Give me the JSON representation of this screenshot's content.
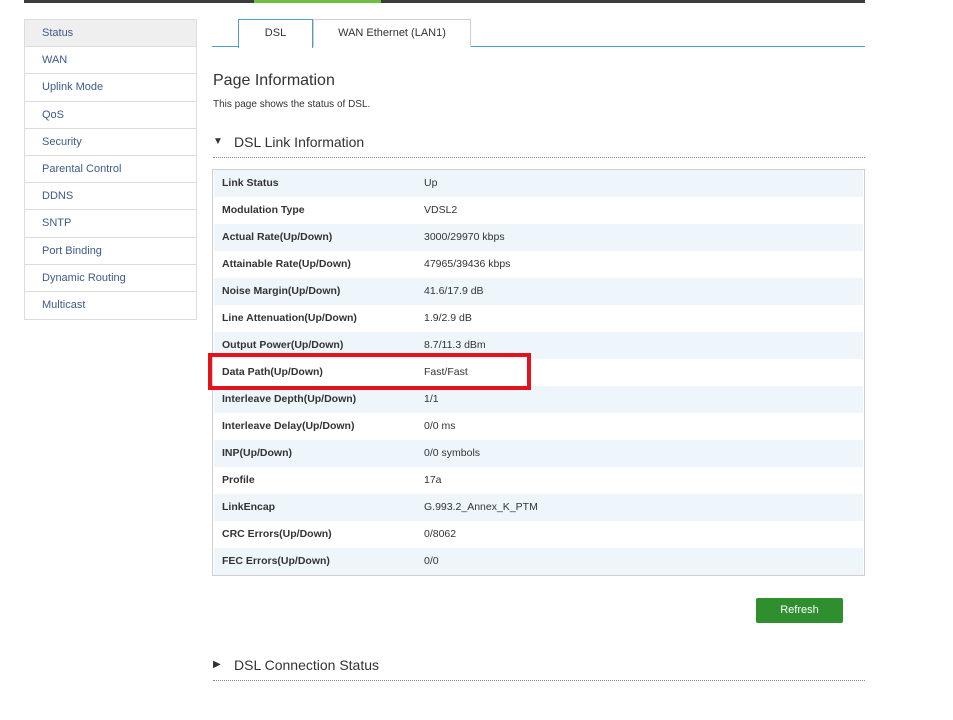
{
  "sidebar": {
    "items": [
      {
        "label": "Status"
      },
      {
        "label": "WAN"
      },
      {
        "label": "Uplink Mode"
      },
      {
        "label": "QoS"
      },
      {
        "label": "Security"
      },
      {
        "label": "Parental Control"
      },
      {
        "label": "DDNS"
      },
      {
        "label": "SNTP"
      },
      {
        "label": "Port Binding"
      },
      {
        "label": "Dynamic Routing"
      },
      {
        "label": "Multicast"
      }
    ]
  },
  "tabs": [
    {
      "label": "DSL"
    },
    {
      "label": "WAN Ethernet (LAN1)"
    }
  ],
  "page": {
    "title": "Page Information",
    "description": "This page shows the status of DSL."
  },
  "sections": {
    "link_info": {
      "label": "DSL Link Information",
      "arrow": "▼"
    },
    "conn_status": {
      "label": "DSL Connection Status",
      "arrow": "▶"
    }
  },
  "table": {
    "rows": [
      {
        "key": "Link Status",
        "value": "Up"
      },
      {
        "key": "Modulation Type",
        "value": "VDSL2"
      },
      {
        "key": "Actual Rate(Up/Down)",
        "value": "3000/29970 kbps"
      },
      {
        "key": "Attainable Rate(Up/Down)",
        "value": "47965/39436 kbps"
      },
      {
        "key": "Noise Margin(Up/Down)",
        "value": "41.6/17.9 dB"
      },
      {
        "key": "Line Attenuation(Up/Down)",
        "value": "1.9/2.9 dB"
      },
      {
        "key": "Output Power(Up/Down)",
        "value": "8.7/11.3 dBm"
      },
      {
        "key": "Data Path(Up/Down)",
        "value": "Fast/Fast"
      },
      {
        "key": "Interleave Depth(Up/Down)",
        "value": "1/1"
      },
      {
        "key": "Interleave Delay(Up/Down)",
        "value": "0/0 ms"
      },
      {
        "key": "INP(Up/Down)",
        "value": "0/0 symbols"
      },
      {
        "key": "Profile",
        "value": "17a"
      },
      {
        "key": "LinkEncap",
        "value": "G.993.2_Annex_K_PTM"
      },
      {
        "key": "CRC Errors(Up/Down)",
        "value": "0/8062"
      },
      {
        "key": "FEC Errors(Up/Down)",
        "value": "0/0"
      }
    ]
  },
  "buttons": {
    "refresh": "Refresh"
  },
  "colors": {
    "accent": "#4aa0c8",
    "highlight": "#e3131b",
    "refresh_button": "#2f8f2f",
    "row_alt": "#eef6fb",
    "link_text": "#3d5a8c"
  }
}
